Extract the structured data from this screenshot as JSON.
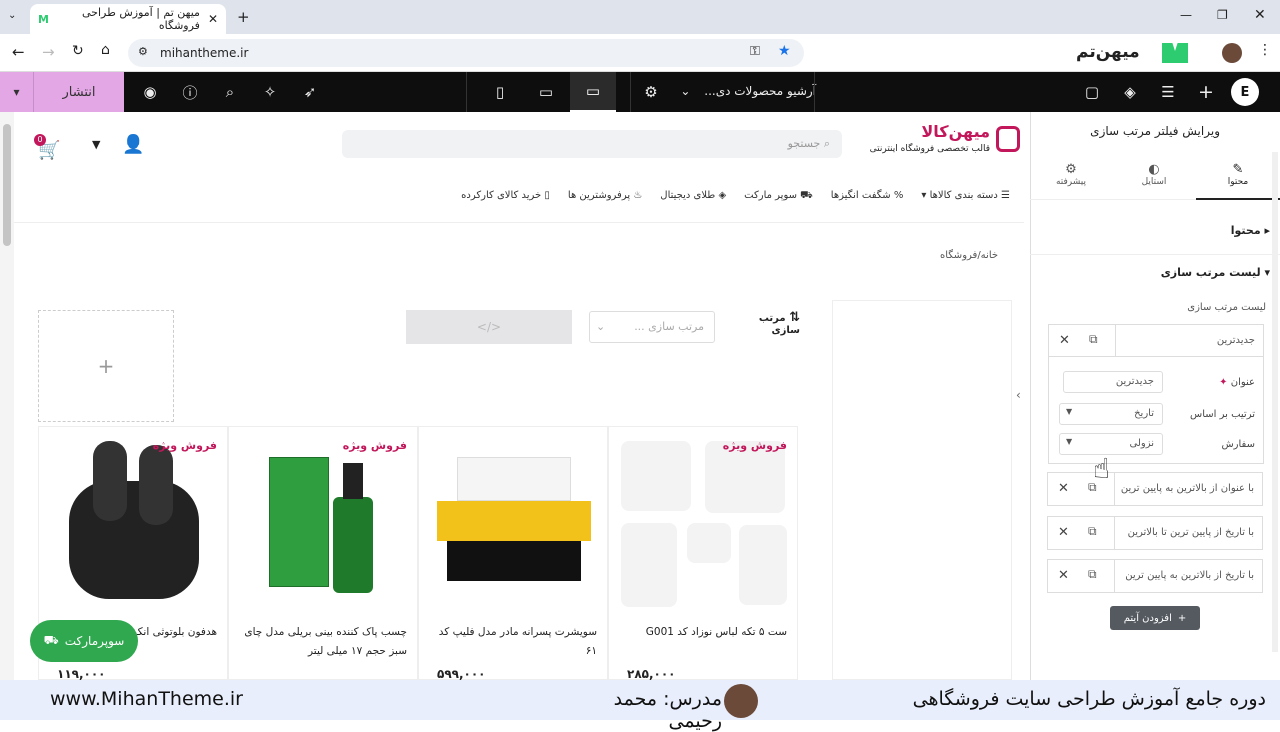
{
  "browser": {
    "tab_title": "میهن تم | آموزش طراحی فروشگاه",
    "url": "mihantheme.ir",
    "brand": "میهن‌تم"
  },
  "editor_top": {
    "publish_label": "انتشار",
    "page_select": "آرشیو محصولات دی...",
    "accent": "#e3a7e6"
  },
  "site": {
    "logo_title": "میهن‌کالا",
    "logo_subtitle": "قالب تخصصی فروشگاه اینترنتی",
    "search_placeholder": "جستجو",
    "cart_count": "0",
    "nav": [
      "دسته بندی کالاها",
      "شگفت انگیزها",
      "سوپر مارکت",
      "طلای دیجیتال",
      "پرفروشترین ها",
      "خرید کالای کارکرده"
    ],
    "breadcrumb": "خانه/فروشگاه",
    "sort_label": "مرتب سازی",
    "sort_placeholder": "مرتب سازی ...",
    "add_plus": "+",
    "code_icon": "</>",
    "supermarket_btn": "سوپرمارکت"
  },
  "products": [
    {
      "title": "ست ۵ تکه لباس نوزاد کد G001",
      "badge": "فروش ویژه",
      "price": "۲۸۵,۰۰۰"
    },
    {
      "title": "سویشرت پسرانه مادر مدل فلیپ کد ۶۱",
      "badge": "",
      "price": "۵۹۹,۰۰۰"
    },
    {
      "title": "چسب پاک کننده بینی بریلی مدل چای سبز حجم ۱۷ میلی لیتر",
      "badge": "فروش ویژه",
      "price": ""
    },
    {
      "title": "هدفون بلوتوثی انکر",
      "badge": "فروش ویژه",
      "price": "۱۱۹,۰۰۰"
    }
  ],
  "panel": {
    "title": "ویرایش فیلتر مرتب سازی",
    "tabs": [
      "محتوا",
      "استایل",
      "پیشرفته"
    ],
    "section_content": "محتوا",
    "section_sort_list": "لیست مرتب سازی",
    "list_label": "لیست مرتب سازی",
    "item_open": {
      "label": "جدیدترین",
      "title_label": "عنوان",
      "title_value": "جدیدترین",
      "order_by_label": "ترتیب بر اساس",
      "order_by_value": "تاریخ",
      "order_label": "سفارش",
      "order_value": "نزولی"
    },
    "items": [
      "با عنوان از بالاترین به پایین ترین",
      "با تاریخ از پایین ترین تا بالاترین",
      "با تاریخ از بالاترین به پایین ترین"
    ],
    "add_item": "افزودن آیتم"
  },
  "footer": {
    "course": "دوره جامع آموزش طراحی سایت فروشگاهی",
    "teacher": "مدرس: محمد رحیمی",
    "site": "www.MihanTheme.ir"
  }
}
